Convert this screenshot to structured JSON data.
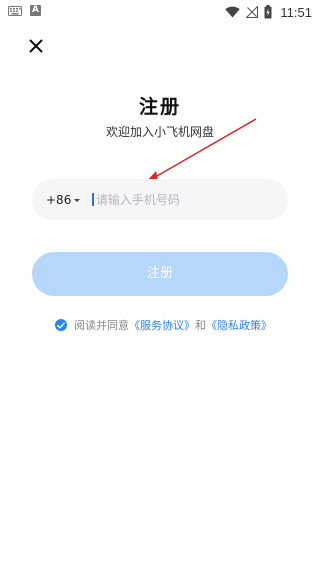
{
  "status_bar": {
    "time": "11:51",
    "notification_letter": "A"
  },
  "icons": {
    "close": "close-icon",
    "keyboard": "keyboard-icon",
    "wifi": "wifi-icon",
    "signal": "signal-icon",
    "battery": "battery-charging-icon",
    "check": "check-icon",
    "dropdown": "chevron-down-icon"
  },
  "page": {
    "title": "注册",
    "subtitle": "欢迎加入小飞机网盘"
  },
  "phone": {
    "country_code": "+86",
    "placeholder": "请输入手机号码",
    "value": ""
  },
  "register_button": {
    "label": "注册"
  },
  "agreement": {
    "checked": true,
    "prefix": "阅读并同意",
    "service_link": "《服务协议》",
    "connector": "和",
    "privacy_link": "《隐私政策》"
  },
  "colors": {
    "accent": "#2a86f5",
    "button_disabled": "#b6d6fb",
    "field_bg": "#f5f6f8",
    "annotation": "#e02424"
  }
}
